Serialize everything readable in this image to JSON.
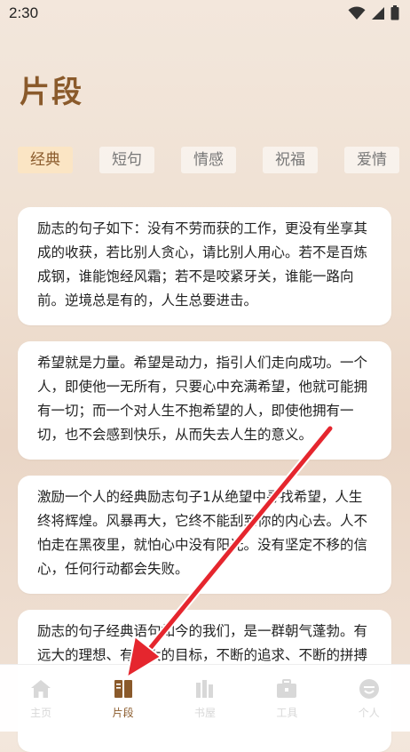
{
  "status_bar": {
    "time": "2:30"
  },
  "page": {
    "title": "片段"
  },
  "tabs": [
    {
      "label": "经典",
      "active": true
    },
    {
      "label": "短句",
      "active": false
    },
    {
      "label": "情感",
      "active": false
    },
    {
      "label": "祝福",
      "active": false
    },
    {
      "label": "爱情",
      "active": false
    }
  ],
  "cards": [
    {
      "text": "励志的句子如下：没有不劳而获的工作，更没有坐享其成的收获，若比别人贪心，请比别人用心。若不是百炼成钢，谁能饱经风霜；若不是咬紧牙关，谁能一路向前。逆境总是有的，人生总要进击。"
    },
    {
      "text": "希望就是力量。希望是动力，指引人们走向成功。一个人，即使他一无所有，只要心中充满希望，他就可能拥有一切；而一个对人生不抱希望的人，即使他拥有一切，也不会感到快乐，从而失去人生的意义。"
    },
    {
      "text": "激励一个人的经典励志句子1从绝望中寻找希望，人生终将辉煌。风暴再大，它终不能刮到你的内心去。人不怕走在黑夜里，就怕心中没有阳光。没有坚定不移的信心，任何行动都会失败。"
    },
    {
      "text": "励志的句子经典语句如今的我们，是一群朝气蓬勃。有远大的理想、有远大的目标，不断的追求、不断的拼搏"
    }
  ],
  "bottom_nav": [
    {
      "label": "主页",
      "icon": "home-icon",
      "active": false
    },
    {
      "label": "片段",
      "icon": "book-icon",
      "active": true
    },
    {
      "label": "书屋",
      "icon": "books-icon",
      "active": false
    },
    {
      "label": "工具",
      "icon": "toolbox-icon",
      "active": false
    },
    {
      "label": "个人",
      "icon": "profile-icon",
      "active": false
    }
  ],
  "colors": {
    "accent": "#8a5a2b",
    "tab_active_bg": "#fbe5c4",
    "annotation_arrow": "#e5262e"
  }
}
